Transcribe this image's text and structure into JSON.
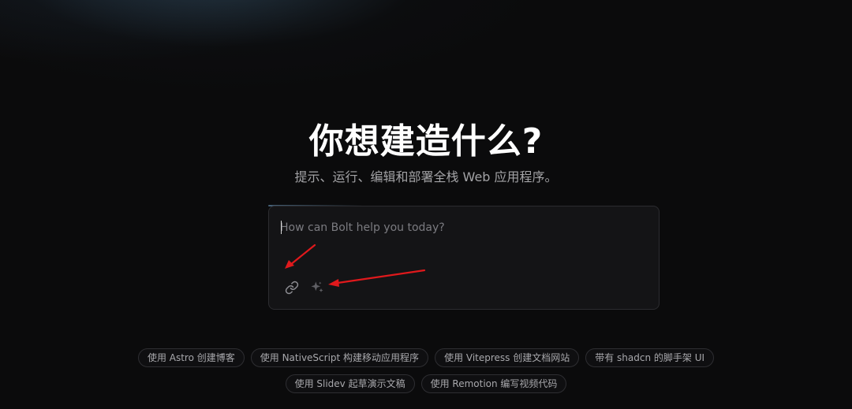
{
  "hero": {
    "title": "你想建造什么?",
    "subtitle": "提示、运行、编辑和部署全栈 Web 应用程序。"
  },
  "prompt": {
    "placeholder": "How can Bolt help you today?",
    "value": ""
  },
  "toolbar": {
    "attach_icon": "link-icon",
    "enhance_icon": "sparkles-icon"
  },
  "suggestions": {
    "row1": [
      "使用 Astro 创建博客",
      "使用 NativeScript 构建移动应用程序",
      "使用 Vitepress 创建文档网站",
      "带有 shadcn 的脚手架 UI"
    ],
    "row2": [
      "使用 Slidev 起草演示文稿",
      "使用 Remotion 编写视频代码"
    ]
  },
  "colors": {
    "background": "#0b0b0c",
    "box_background": "#141416",
    "annotation_arrow": "#e0191c"
  }
}
